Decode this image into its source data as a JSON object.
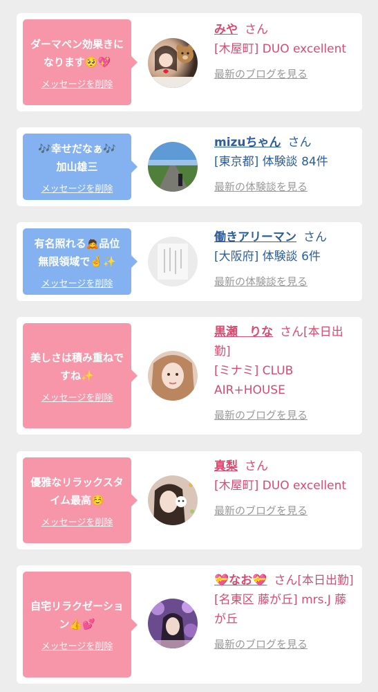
{
  "cards": [
    {
      "message": "ダーマペン効果きになります🥺💖",
      "delete_label": "メッセージを削除",
      "name": "みや",
      "honorific": "さん",
      "meta": "[木屋町] DUO excellent",
      "link": "最新のブログを見る"
    },
    {
      "message": "🎶幸せだなぁ🎶加山雄三",
      "delete_label": "メッセージを削除",
      "name": "mizuちゃん",
      "honorific": "さん",
      "meta": "[東京都] 体験談 84件",
      "link": "最新の体験談を見る"
    },
    {
      "message": "有名照れる🙇品位無限領域で🤞✨",
      "delete_label": "メッセージを削除",
      "name": "働きアリーマン",
      "honorific": "さん",
      "meta": "[大阪府] 体験談 6件",
      "link": "最新の体験談を見る"
    },
    {
      "message": "美しさは積み重ねですね✨",
      "delete_label": "メッセージを削除",
      "name": "黒瀬　りな",
      "honorific": "さん[本日出勤]",
      "meta": "[ミナミ] CLUB AIR+HOUSE",
      "link": "最新のブログを見る"
    },
    {
      "message": "優雅なリラックスタイム最高☺️",
      "delete_label": "メッセージを削除",
      "name": "真梨",
      "honorific": "さん",
      "meta": "[木屋町] DUO excellent",
      "link": "最新のブログを見る"
    },
    {
      "message": "自宅リラクゼーション👍💕",
      "delete_label": "メッセージを削除",
      "name": "💝なお💝",
      "honorific": "さん[本日出勤]",
      "meta": "[名東区 藤が丘] mrs.J 藤が丘",
      "link": "最新のブログを見る"
    }
  ]
}
